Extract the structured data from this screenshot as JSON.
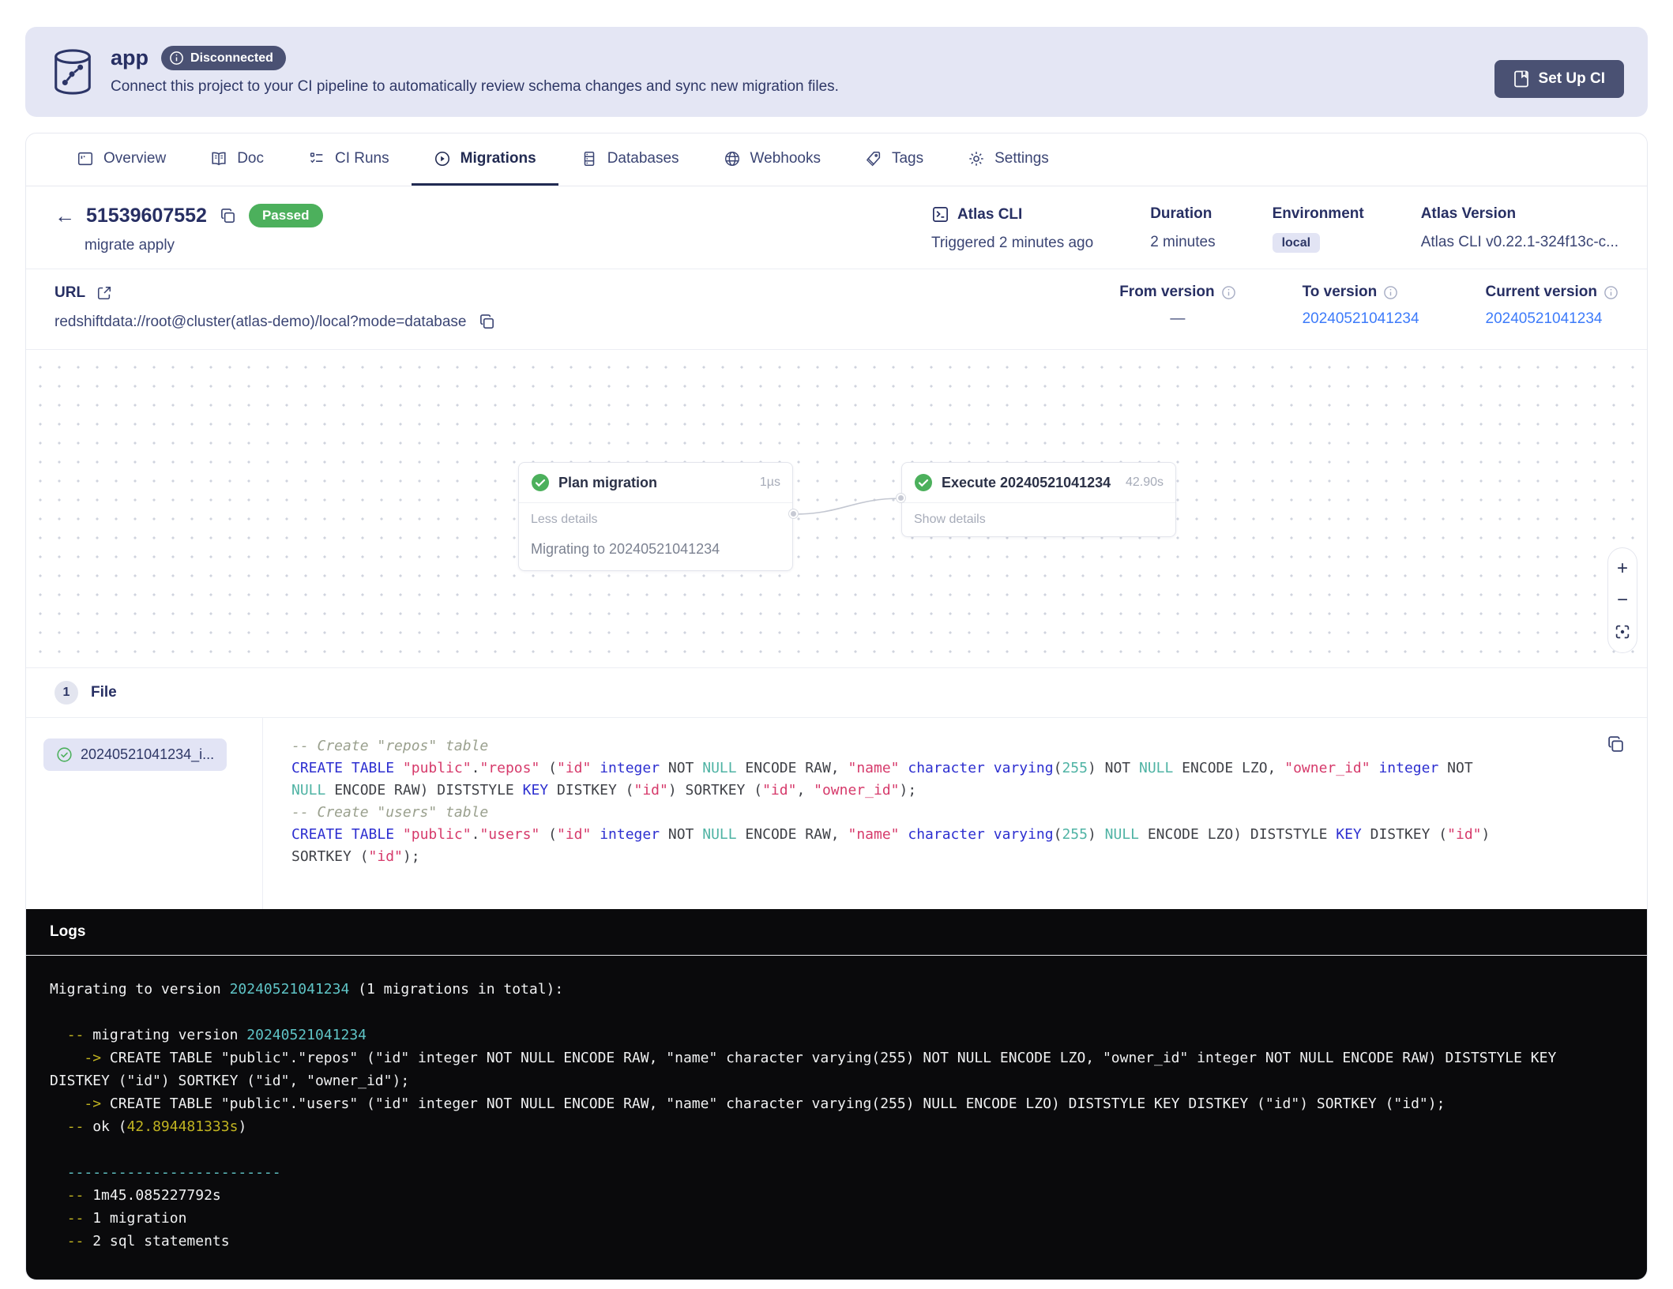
{
  "colors": {
    "banner_bg": "#e4e6f4",
    "accent_navy": "#272f63",
    "slate_button": "#4a5173",
    "passed_green": "#4cb05c",
    "link_blue": "#3d7bfa",
    "env_badge_bg": "#e2e4f4",
    "code_keyword": "#2d2fd0",
    "code_string": "#d63a6b",
    "code_number": "#4fb3a4",
    "code_comment": "#9aa08e",
    "log_cyan": "#5fc4c6",
    "log_yellow": "#c0b321",
    "log_bg": "#0a0a0c"
  },
  "banner": {
    "app_name": "app",
    "status_badge": "Disconnected",
    "description": "Connect this project to your CI pipeline to automatically review schema changes and sync new migration files.",
    "setup_ci_button": "Set Up CI"
  },
  "tabs": [
    {
      "label": "Overview"
    },
    {
      "label": "Doc"
    },
    {
      "label": "CI Runs"
    },
    {
      "label": "Migrations"
    },
    {
      "label": "Databases"
    },
    {
      "label": "Webhooks"
    },
    {
      "label": "Tags"
    },
    {
      "label": "Settings"
    }
  ],
  "run_header": {
    "id": "51539607552",
    "status": "Passed",
    "command": "migrate apply",
    "trigger_label": "Atlas CLI",
    "trigger_sub": "Triggered 2 minutes ago",
    "duration_label": "Duration",
    "duration_value": "2 minutes",
    "environment_label": "Environment",
    "environment_value": "local",
    "version_label": "Atlas Version",
    "version_value": "Atlas CLI v0.22.1-324f13c-c..."
  },
  "connection": {
    "url_label": "URL",
    "url": "redshiftdata://root@cluster(atlas-demo)/local?mode=database",
    "from_label": "From version",
    "from_value": "—",
    "to_label": "To version",
    "to_value": "20240521041234",
    "current_label": "Current version",
    "current_value": "20240521041234"
  },
  "flow": {
    "plan_node": {
      "title": "Plan migration",
      "duration": "1µs",
      "toggle": "Less details",
      "detail": "Migrating to 20240521041234"
    },
    "execute_node": {
      "title": "Execute 20240521041234",
      "duration": "42.90s",
      "toggle": "Show details"
    }
  },
  "file_section": {
    "count": "1",
    "label": "File",
    "file_name": "20240521041234_i...",
    "code_lines": [
      [
        [
          "cm",
          "-- Create \"repos\" table"
        ]
      ],
      [
        [
          "kw",
          "CREATE TABLE"
        ],
        [
          "pl",
          " "
        ],
        [
          "str",
          "\"public\""
        ],
        [
          "pl",
          "."
        ],
        [
          "str",
          "\"repos\""
        ],
        [
          "pl",
          " ("
        ],
        [
          "str",
          "\"id\""
        ],
        [
          "pl",
          " "
        ],
        [
          "kw",
          "integer"
        ],
        [
          "pl",
          " NOT "
        ],
        [
          "num",
          "NULL"
        ],
        [
          "pl",
          " ENCODE RAW, "
        ],
        [
          "str",
          "\"name\""
        ],
        [
          "pl",
          " "
        ],
        [
          "kw",
          "character varying"
        ],
        [
          "pl",
          "("
        ],
        [
          "num",
          "255"
        ],
        [
          "pl",
          ") NOT "
        ],
        [
          "num",
          "NULL"
        ],
        [
          "pl",
          " ENCODE LZO, "
        ],
        [
          "str",
          "\"owner_id\""
        ],
        [
          "pl",
          " "
        ],
        [
          "kw",
          "integer"
        ],
        [
          "pl",
          " NOT "
        ],
        [
          "num",
          "NULL"
        ],
        [
          "pl",
          " ENCODE RAW) DISTSTYLE "
        ],
        [
          "kw",
          "KEY"
        ],
        [
          "pl",
          " DISTKEY ("
        ],
        [
          "str",
          "\"id\""
        ],
        [
          "pl",
          ") SORTKEY ("
        ],
        [
          "str",
          "\"id\""
        ],
        [
          "pl",
          ", "
        ],
        [
          "str",
          "\"owner_id\""
        ],
        [
          "pl",
          ");"
        ]
      ],
      [
        [
          "cm",
          "-- Create \"users\" table"
        ]
      ],
      [
        [
          "kw",
          "CREATE TABLE"
        ],
        [
          "pl",
          " "
        ],
        [
          "str",
          "\"public\""
        ],
        [
          "pl",
          "."
        ],
        [
          "str",
          "\"users\""
        ],
        [
          "pl",
          " ("
        ],
        [
          "str",
          "\"id\""
        ],
        [
          "pl",
          " "
        ],
        [
          "kw",
          "integer"
        ],
        [
          "pl",
          " NOT "
        ],
        [
          "num",
          "NULL"
        ],
        [
          "pl",
          " ENCODE RAW, "
        ],
        [
          "str",
          "\"name\""
        ],
        [
          "pl",
          " "
        ],
        [
          "kw",
          "character varying"
        ],
        [
          "pl",
          "("
        ],
        [
          "num",
          "255"
        ],
        [
          "pl",
          ") "
        ],
        [
          "num",
          "NULL"
        ],
        [
          "pl",
          " ENCODE LZO) DISTSTYLE "
        ],
        [
          "kw",
          "KEY"
        ],
        [
          "pl",
          " DISTKEY ("
        ],
        [
          "str",
          "\"id\""
        ],
        [
          "pl",
          ") SORTKEY ("
        ],
        [
          "str",
          "\"id\""
        ],
        [
          "pl",
          ");"
        ]
      ]
    ]
  },
  "logs": {
    "title": "Logs",
    "lines": [
      [
        [
          "w",
          "Migrating to version "
        ],
        [
          "c",
          "20240521041234"
        ],
        [
          "w",
          " (1 migrations in total):"
        ]
      ],
      [],
      [
        [
          "w",
          "  "
        ],
        [
          "y",
          "--"
        ],
        [
          "w",
          " migrating version "
        ],
        [
          "c",
          "20240521041234"
        ]
      ],
      [
        [
          "w",
          "    "
        ],
        [
          "y",
          "->"
        ],
        [
          "w",
          " CREATE TABLE \"public\".\"repos\" (\"id\" integer NOT NULL ENCODE RAW, \"name\" character varying(255) NOT NULL ENCODE LZO, \"owner_id\" integer NOT NULL ENCODE RAW) DISTSTYLE KEY DISTKEY (\"id\") SORTKEY (\"id\", \"owner_id\");"
        ]
      ],
      [
        [
          "w",
          "    "
        ],
        [
          "y",
          "->"
        ],
        [
          "w",
          " CREATE TABLE \"public\".\"users\" (\"id\" integer NOT NULL ENCODE RAW, \"name\" character varying(255) NULL ENCODE LZO) DISTSTYLE KEY DISTKEY (\"id\") SORTKEY (\"id\");"
        ]
      ],
      [
        [
          "w",
          "  "
        ],
        [
          "y",
          "--"
        ],
        [
          "w",
          " ok ("
        ],
        [
          "y",
          "42.894481333s"
        ],
        [
          "w",
          ")"
        ]
      ],
      [],
      [
        [
          "c",
          "  -------------------------"
        ]
      ],
      [
        [
          "w",
          "  "
        ],
        [
          "y",
          "--"
        ],
        [
          "w",
          " 1m45.085227792s"
        ]
      ],
      [
        [
          "w",
          "  "
        ],
        [
          "y",
          "--"
        ],
        [
          "w",
          " 1 migration"
        ]
      ],
      [
        [
          "w",
          "  "
        ],
        [
          "y",
          "--"
        ],
        [
          "w",
          " 2 sql statements"
        ]
      ]
    ]
  }
}
